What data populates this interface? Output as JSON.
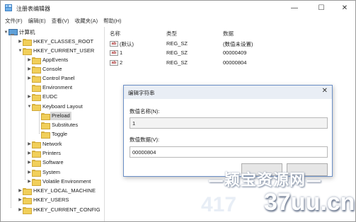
{
  "window": {
    "title": "注册表编辑器"
  },
  "controls": {
    "minimize": "—",
    "maximize": "☐",
    "close": "✕"
  },
  "menu": [
    "文件(F)",
    "编辑(E)",
    "查看(V)",
    "收藏夹(A)",
    "帮助(H)"
  ],
  "tree": {
    "root": "计算机",
    "items": [
      {
        "label": "HKEY_CLASSES_ROOT",
        "expanded": false,
        "selected": false
      },
      {
        "label": "HKEY_CURRENT_USER",
        "expanded": true,
        "selected": false
      },
      {
        "label": "AppEvents",
        "expanded": false,
        "selected": false
      },
      {
        "label": "Console",
        "expanded": false,
        "selected": false
      },
      {
        "label": "Control Panel",
        "expanded": false,
        "selected": false
      },
      {
        "label": "Environment",
        "expanded": false,
        "selected": false
      },
      {
        "label": "EUDC",
        "expanded": false,
        "selected": false
      },
      {
        "label": "Keyboard Layout",
        "expanded": true,
        "selected": false
      },
      {
        "label": "Preload",
        "expanded": false,
        "selected": true
      },
      {
        "label": "Substitutes",
        "expanded": false,
        "selected": false
      },
      {
        "label": "Toggle",
        "expanded": false,
        "selected": false
      },
      {
        "label": "Network",
        "expanded": false,
        "selected": false
      },
      {
        "label": "Printers",
        "expanded": false,
        "selected": false
      },
      {
        "label": "Software",
        "expanded": false,
        "selected": false
      },
      {
        "label": "System",
        "expanded": false,
        "selected": false
      },
      {
        "label": "Volatile Environment",
        "expanded": false,
        "selected": false
      },
      {
        "label": "HKEY_LOCAL_MACHINE",
        "expanded": false,
        "selected": false
      },
      {
        "label": "HKEY_USERS",
        "expanded": false,
        "selected": false
      },
      {
        "label": "HKEY_CURRENT_CONFIG",
        "expanded": false,
        "selected": false
      }
    ]
  },
  "list": {
    "headers": {
      "name": "名称",
      "type": "类型",
      "data": "数据"
    },
    "rows": [
      {
        "icon": "ab",
        "name": "(默认)",
        "type": "REG_SZ",
        "data": "(数值未设置)"
      },
      {
        "icon": "ab",
        "name": "1",
        "type": "REG_SZ",
        "data": "00000409"
      },
      {
        "icon": "ab",
        "name": "2",
        "type": "REG_SZ",
        "data": "00000804"
      }
    ]
  },
  "dialog": {
    "title": "编辑字符串",
    "close": "✕",
    "name_label": "数值名称(N):",
    "name_value": "1",
    "data_label": "数值数据(V):",
    "data_value": "00000804"
  },
  "watermark": {
    "line1": "—颖宝资源网—",
    "line2a": "417",
    "line2b": "37uu.cn"
  }
}
